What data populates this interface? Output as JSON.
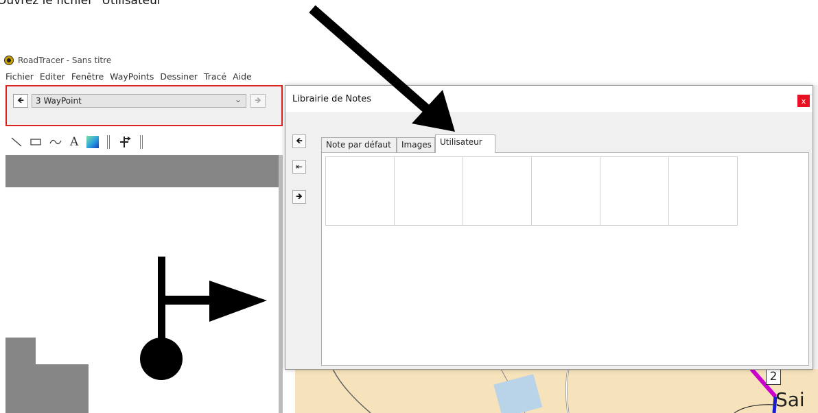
{
  "instruction": {
    "text": "Ouvrez le fichier \"Utilisateur\""
  },
  "app": {
    "title": "RoadTracer - Sans titre",
    "menu": [
      "Fichier",
      "Editer",
      "Fenêtre",
      "WayPoints",
      "Dessiner",
      "Tracé",
      "Aide"
    ]
  },
  "waypoint": {
    "selected": "3 WayPoint",
    "back_icon": "arrow-left-icon",
    "forward_icon": "arrow-right-icon"
  },
  "toolbar": {
    "tools": [
      "line-tool-icon",
      "rectangle-tool-icon",
      "curve-tool-icon",
      "text-tool-icon",
      "fill-tool-icon",
      "direction-tool-icon"
    ],
    "text_tool_glyph": "A"
  },
  "dialog": {
    "title": "Librairie de Notes",
    "close_label": "x",
    "tabs": [
      {
        "label": "Note par défaut",
        "active": false
      },
      {
        "label": "Images",
        "active": false
      },
      {
        "label": "Utilisateur",
        "active": true
      }
    ],
    "side_buttons": [
      "arrow-left-icon",
      "arrow-to-start-icon",
      "arrow-right-icon"
    ],
    "note_cells": 6
  },
  "map": {
    "waypoint_number": "2",
    "place_label": "Sai"
  },
  "colors": {
    "highlight_border": "#dd2222",
    "close_button": "#e81123",
    "map_background": "#f6e2bb",
    "route": "#cc00cc"
  }
}
